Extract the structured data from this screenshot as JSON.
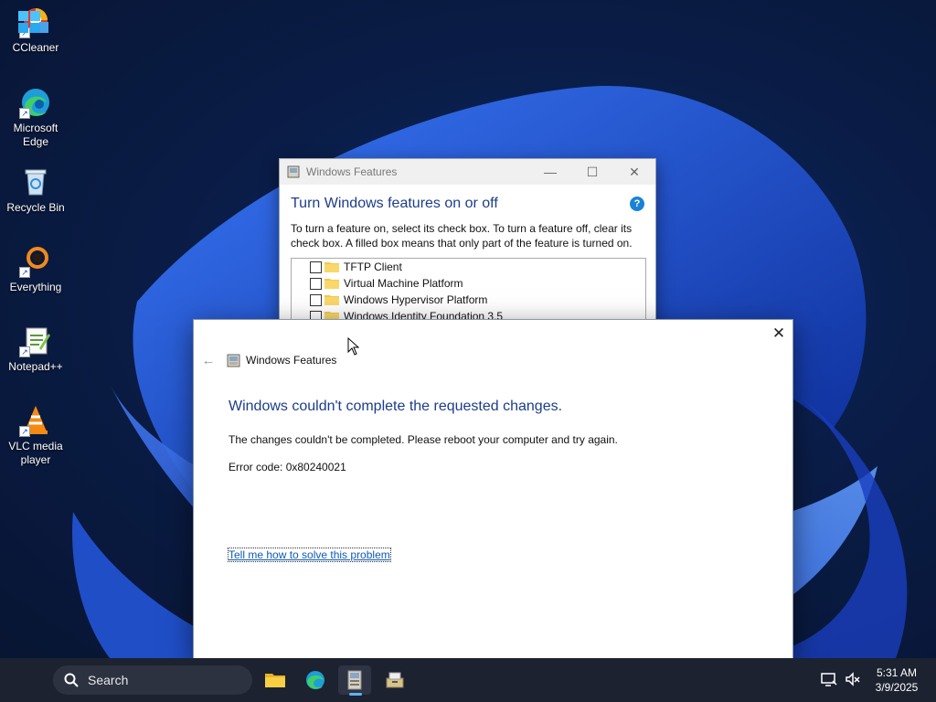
{
  "desktop": {
    "icons": [
      {
        "label": "CCleaner",
        "icon": "ccleaner-icon"
      },
      {
        "label": "Microsoft Edge",
        "icon": "edge-icon"
      },
      {
        "label": "Recycle Bin",
        "icon": "recycle-bin-icon"
      },
      {
        "label": "Everything",
        "icon": "everything-icon"
      },
      {
        "label": "Notepad++",
        "icon": "notepadpp-icon"
      },
      {
        "label": "VLC media player",
        "icon": "vlc-icon"
      }
    ]
  },
  "features_window": {
    "title": "Windows Features",
    "heading": "Turn Windows features on or off",
    "description": "To turn a feature on, select its check box. To turn a feature off, clear its check box. A filled box means that only part of the feature is turned on.",
    "features": [
      {
        "label": "TFTP Client",
        "checked": false
      },
      {
        "label": "Virtual Machine Platform",
        "checked": false
      },
      {
        "label": "Windows Hypervisor Platform",
        "checked": false
      },
      {
        "label": "Windows Identity Foundation 3.5",
        "checked": false
      }
    ],
    "help_label": "?",
    "minimize_label": "—",
    "maximize_label": "☐",
    "close_label": "✕"
  },
  "error_dialog": {
    "app_title": "Windows Features",
    "heading": "Windows couldn't complete the requested changes.",
    "message": "The changes couldn't be completed. Please reboot your computer and try again.",
    "error_code": "Error code: 0x80240021",
    "help_link": "Tell me how to solve this problem",
    "back_label": "←",
    "close_label": "✕"
  },
  "taskbar": {
    "search_placeholder": "Search",
    "apps": [
      "file-explorer-icon",
      "edge-icon",
      "windows-features-icon",
      "installer-icon"
    ],
    "time": "5:31 AM",
    "date": "3/9/2025"
  },
  "colors": {
    "heading_blue": "#1c3d8a",
    "link_blue": "#0b5ab8",
    "taskbar_bg": "#1c2230"
  }
}
